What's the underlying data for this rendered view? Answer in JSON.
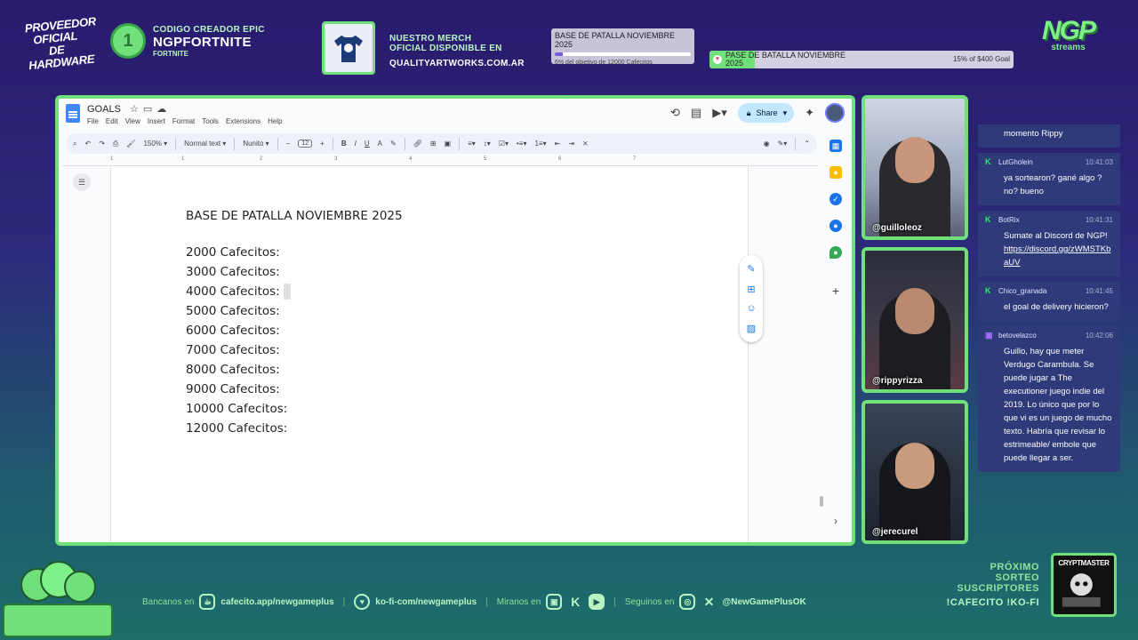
{
  "top": {
    "hardware_logo": "PROVEEDOR OFICIAL DE HARDWARE",
    "creator_line1": "CODIGO CREADOR EPIC",
    "creator_line2": "NGPFORTNITE",
    "creator_line3": "FORTNITE",
    "merch_line1": "NUESTRO MERCH",
    "merch_line2": "OFICIAL DISPONIBLE EN",
    "merch_url": "QUALITYARTWORKS.COM.AR",
    "goal1": {
      "title": "BASE DE PATALLA NOVIEMBRE 2025",
      "subtitle": "6% del objetivo de 12000 Cafecitos",
      "progress": 0.06
    },
    "goal2": {
      "title": "PASE DE BATALLA NOVIEMBRE 2025",
      "right": "15% of $400 Goal",
      "progress": 0.15
    },
    "ngp_logo": "NGP",
    "ngp_sub": "streams"
  },
  "docs": {
    "title": "GOALS",
    "menu": [
      "File",
      "Edit",
      "View",
      "Insert",
      "Format",
      "Tools",
      "Extensions",
      "Help"
    ],
    "share_label": "Share",
    "toolbar": {
      "zoom": "150%",
      "style": "Normal text",
      "font": "Nunito",
      "font_size": "12"
    },
    "ruler_marks": [
      "1",
      "1",
      "2",
      "3",
      "4",
      "5",
      "6",
      "7"
    ],
    "heading": "BASE DE PATALLA NOVIEMBRE 2025",
    "lines": [
      "2000 Cafecitos:",
      "3000 Cafecitos:",
      "4000 Cafecitos:",
      "5000 Cafecitos:",
      "6000 Cafecitos:",
      "7000 Cafecitos:",
      "8000 Cafecitos:",
      "9000 Cafecitos:",
      "10000 Cafecitos:",
      "12000 Cafecitos:"
    ]
  },
  "cams": [
    {
      "handle": "@guilloleoz"
    },
    {
      "handle": "@rippyrizza"
    },
    {
      "handle": "@jerecurel"
    }
  ],
  "chat": [
    {
      "user": "",
      "time": "",
      "text": "Ya vas a volver a tu mejor momento Rippy",
      "platform": "kick"
    },
    {
      "user": "LutGholein",
      "time": "10:41:03",
      "text": "ya sortearon? gané algo ? no? bueno",
      "platform": "kick"
    },
    {
      "user": "BotRix",
      "time": "10:41:31",
      "text": "Sumate al Discord de NGP!",
      "link": "https://discord.gg/zWMSTKbaUV",
      "platform": "kick"
    },
    {
      "user": "Chico_granada",
      "time": "10:41:45",
      "text": "el goal de delivery hicieron?",
      "platform": "kick"
    },
    {
      "user": "betovelazco",
      "time": "10:42:06",
      "text": "Guillo, hay que meter Verdugo Carambula. Se puede jugar a The executioner juego indie del 2019. Lo único que por lo que vi es un juego de mucho texto. Habría que revisar lo estrimeable/ embole que puede llegar a ser.",
      "platform": "twitch"
    }
  ],
  "bottom": {
    "bancanos": "Bancanos en",
    "cafecito": "cafecito.app/newgameplus",
    "kofi": "ko-fi-com/newgameplus",
    "miranos": "Miranos en",
    "seguinos": "Seguinos en",
    "handle": "@NewGamePlusOK",
    "sorteo_l1": "PRÓXIMO",
    "sorteo_l2": "SORTEO",
    "sorteo_l3": "SUSCRIPTORES",
    "sorteo_cmd": "!CAFECITO !KO-FI",
    "crypt_title": "CRYPTMASTER"
  },
  "colors": {
    "accent_green": "#6fe07a",
    "chat_bg": "#2f3a7a",
    "bg_purple": "#2a1a6e",
    "bg_teal": "#1c6e6a"
  }
}
